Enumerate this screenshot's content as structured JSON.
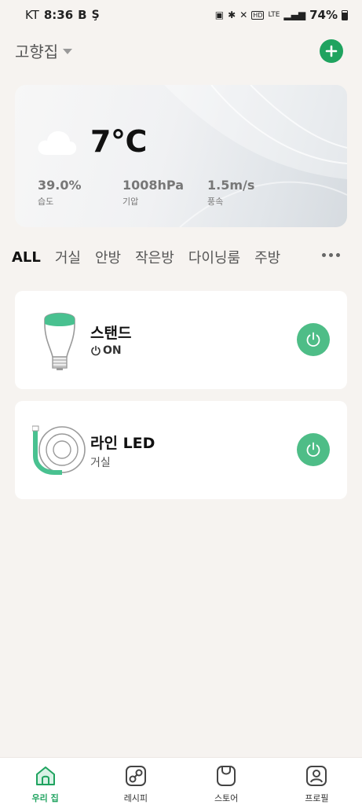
{
  "status_bar": {
    "carrier": "KT",
    "time": "8:36",
    "b_badge": "B",
    "network": "LTE",
    "hd": "HD",
    "battery": "74%"
  },
  "header": {
    "home_name": "고향집"
  },
  "weather": {
    "temperature": "7°C",
    "humidity_value": "39.0%",
    "humidity_label": "습도",
    "pressure_value": "1008hPa",
    "pressure_label": "기압",
    "wind_value": "1.5m/s",
    "wind_label": "풍속"
  },
  "room_tabs": [
    "ALL",
    "거실",
    "안방",
    "작은방",
    "다이닝룸",
    "주방"
  ],
  "devices": [
    {
      "name": "스탠드",
      "status": "ON",
      "icon": "bulb-icon"
    },
    {
      "name": "라인 LED",
      "room": "거실",
      "icon": "led-strip-icon"
    }
  ],
  "bottom_nav": [
    {
      "label": "우리 집",
      "icon": "home-icon",
      "active": true
    },
    {
      "label": "레시피",
      "icon": "recipe-icon",
      "active": false
    },
    {
      "label": "스토어",
      "icon": "store-icon",
      "active": false
    },
    {
      "label": "프로필",
      "icon": "profile-icon",
      "active": false
    }
  ],
  "colors": {
    "accent": "#1fa35f",
    "power_on": "#4ebd87",
    "background": "#f6f3f0"
  }
}
